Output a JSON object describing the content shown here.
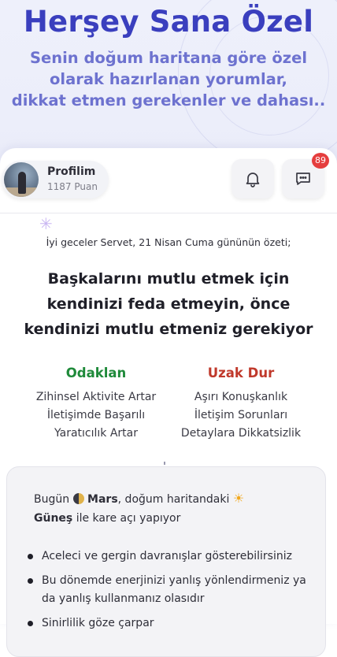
{
  "hero": {
    "title": "Herşey Sana Özel",
    "subtitle_line1": "Senin doğum haritana göre özel",
    "subtitle_line2": "olarak hazırlanan yorumlar,",
    "subtitle_line3": "dikkat etmen gerekenler ve dahası.."
  },
  "profile": {
    "label": "Profilim",
    "points": "1187 Puan"
  },
  "notifications": {
    "icon": "bell-icon"
  },
  "messages": {
    "icon": "chat-icon",
    "badge": "89"
  },
  "summary": "İyi geceler Servet, 21 Nisan Cuma gününün özeti;",
  "headline": {
    "line1": "Başkalarını mutlu etmek için",
    "line2": "kendinizi feda etmeyin, önce",
    "line3": "kendinizi mutlu etmeniz gerekiyor"
  },
  "focus": {
    "title": "Odaklan",
    "color": "#1f8a3a",
    "items": [
      "Zihinsel Aktivite Artar",
      "İletişimde Başarılı",
      "Yaratıcılık Artar"
    ]
  },
  "avoid": {
    "title": "Uzak Dur",
    "color": "#c0392b",
    "items": [
      "Aşırı Konuşkanlık",
      "İletişim Sorunları",
      "Detaylara Dikkatsizlik"
    ]
  },
  "aspect": {
    "prefix": "Bugün",
    "planet1": "Mars",
    "middle": ", doğum haritandaki",
    "planet2": "Güneş",
    "suffix": "ile kare açı yapıyor"
  },
  "bullets": [
    "Aceleci ve gergin davranışlar gösterebilirsiniz",
    "Bu dönemde enerjinizi yanlış yönlendirmeniz ya da yanlış kullanmanız olasıdır",
    "Sinirlilik göze çarpar"
  ]
}
